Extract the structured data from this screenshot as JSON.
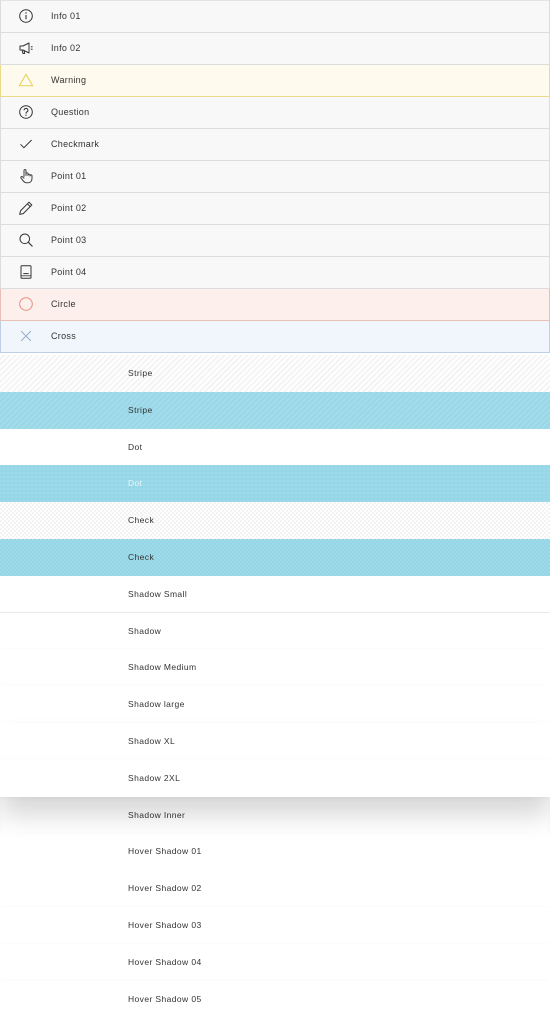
{
  "icon_rows": [
    {
      "label": "Info 01",
      "icon": "info-circle-icon"
    },
    {
      "label": "Info 02",
      "icon": "megaphone-icon"
    },
    {
      "label": "Warning",
      "icon": "warning-triangle-icon"
    },
    {
      "label": "Question",
      "icon": "question-circle-icon"
    },
    {
      "label": "Checkmark",
      "icon": "checkmark-icon"
    },
    {
      "label": "Point 01",
      "icon": "hand-pointer-icon"
    },
    {
      "label": "Point 02",
      "icon": "pencil-icon"
    },
    {
      "label": "Point 03",
      "icon": "magnifier-icon"
    },
    {
      "label": "Point 04",
      "icon": "book-icon"
    },
    {
      "label": "Circle",
      "icon": "circle-icon"
    },
    {
      "label": "Cross",
      "icon": "cross-icon"
    }
  ],
  "style_rows": [
    {
      "label": "Stripe"
    },
    {
      "label": "Stripe"
    },
    {
      "label": "Dot"
    },
    {
      "label": "Dot"
    },
    {
      "label": "Check"
    },
    {
      "label": "Check"
    },
    {
      "label": "Shadow Small"
    },
    {
      "label": "Shadow"
    },
    {
      "label": "Shadow Medium"
    },
    {
      "label": "Shadow large"
    },
    {
      "label": "Shadow XL"
    },
    {
      "label": "Shadow 2XL"
    },
    {
      "label": "Shadow Inner"
    },
    {
      "label": "Hover Shadow 01"
    },
    {
      "label": "Hover Shadow 02"
    },
    {
      "label": "Hover Shadow 03"
    },
    {
      "label": "Hover Shadow 04"
    },
    {
      "label": "Hover Shadow 05"
    }
  ],
  "colors": {
    "warning_accent": "#e6cf54",
    "circle_accent": "#e58c7e",
    "cross_accent": "#8fa8c8",
    "highlight_blue": "#9ad9e9"
  }
}
